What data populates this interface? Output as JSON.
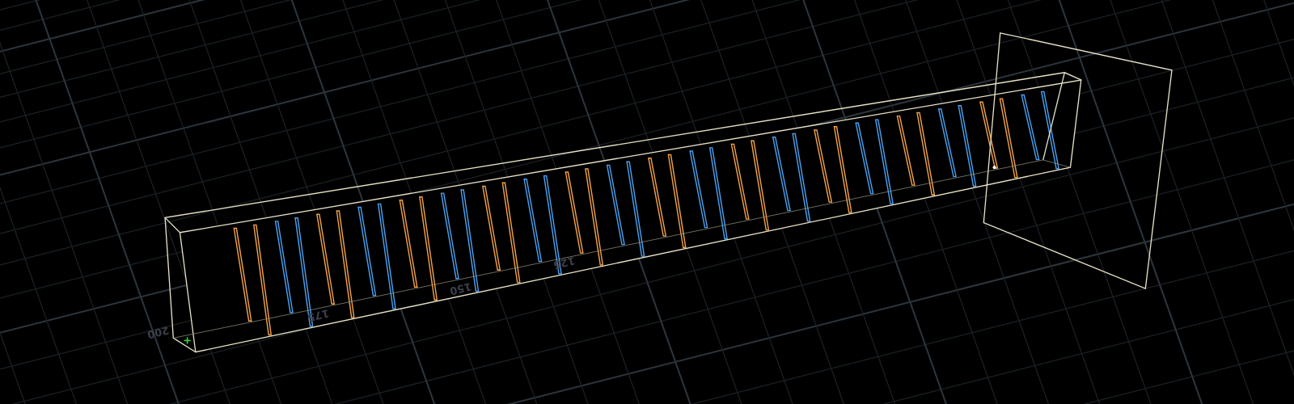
{
  "viewport": {
    "grid_labels": [
      {
        "text": "200"
      },
      {
        "text": "175"
      },
      {
        "text": "150"
      },
      {
        "text": "125"
      }
    ],
    "plates": [
      {
        "color": "#f0a04a"
      },
      {
        "color": "#4aa0f0"
      },
      {
        "color": "#f0a04a"
      },
      {
        "color": "#4aa0f0"
      },
      {
        "color": "#f0a04a"
      },
      {
        "color": "#4aa0f0"
      },
      {
        "color": "#f0a04a"
      },
      {
        "color": "#4aa0f0"
      },
      {
        "color": "#f0a04a"
      },
      {
        "color": "#4aa0f0"
      },
      {
        "color": "#f0a04a"
      },
      {
        "color": "#4aa0f0"
      },
      {
        "color": "#f0a04a"
      },
      {
        "color": "#4aa0f0"
      },
      {
        "color": "#f0a04a"
      },
      {
        "color": "#4aa0f0"
      },
      {
        "color": "#f0a04a"
      },
      {
        "color": "#4aa0f0"
      },
      {
        "color": "#f0a04a"
      },
      {
        "color": "#4aa0f0"
      }
    ]
  }
}
